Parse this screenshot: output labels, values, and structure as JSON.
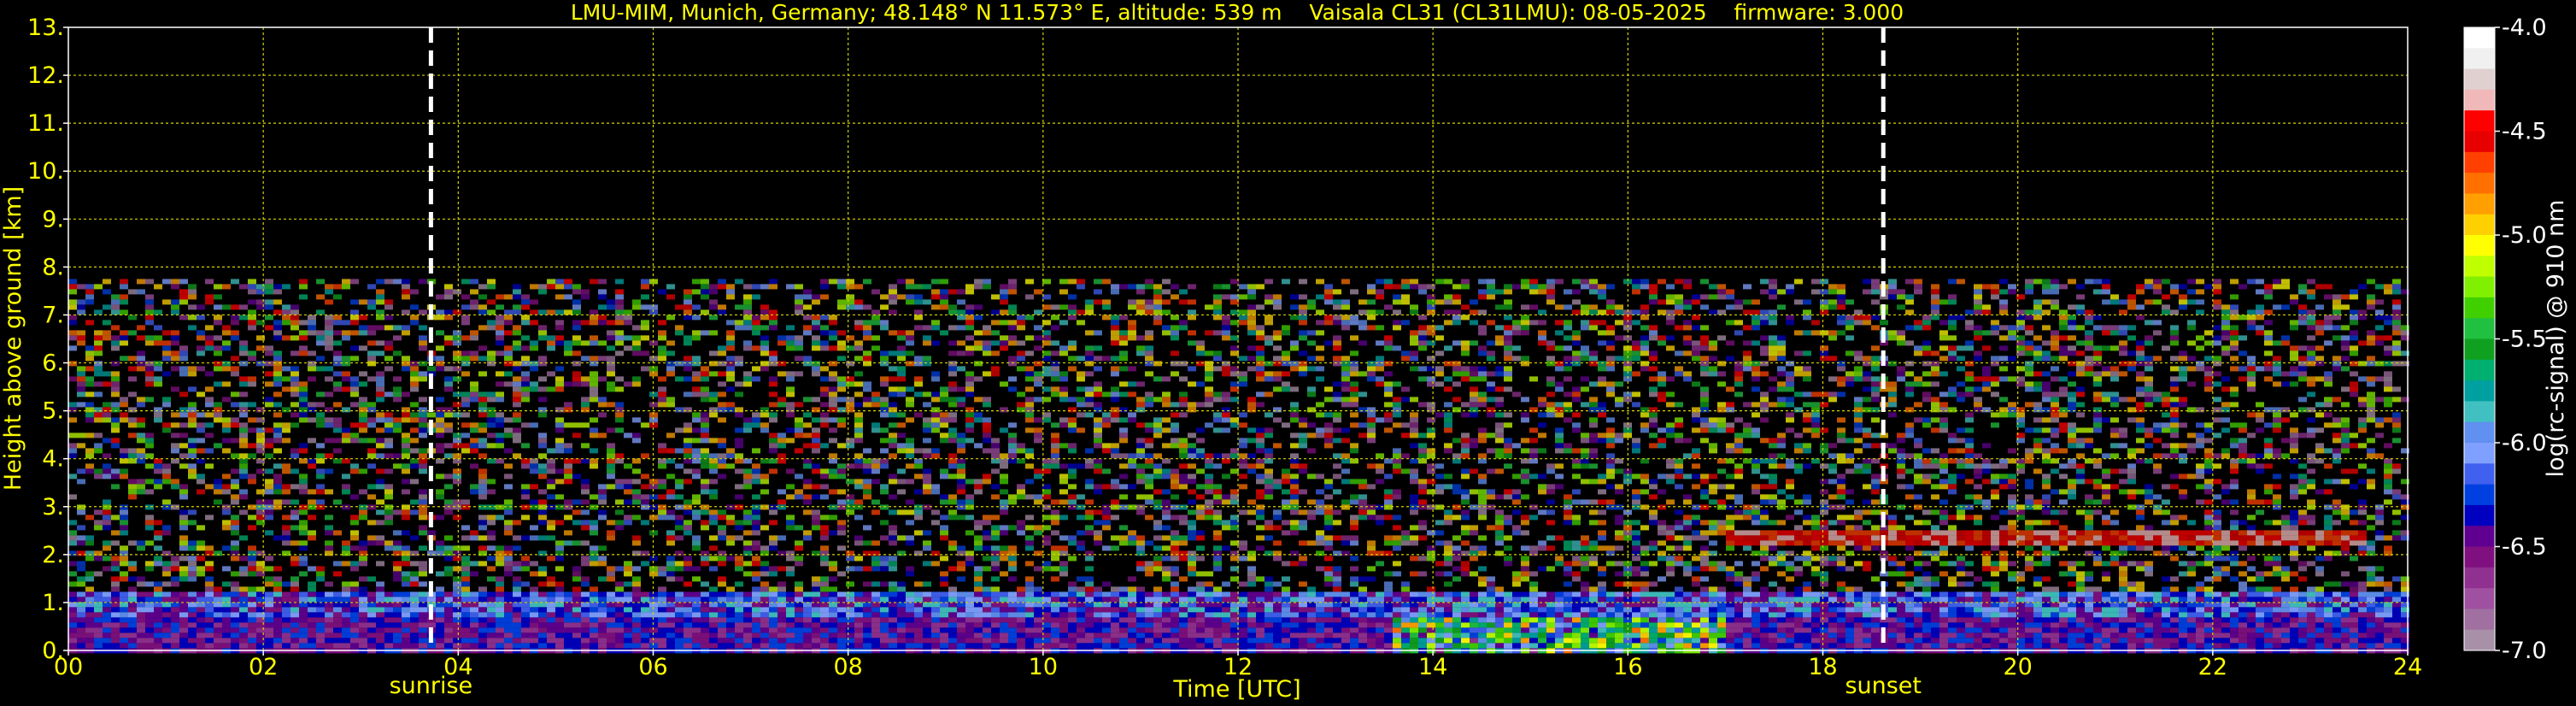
{
  "chart_data": {
    "type": "heatmap",
    "title": "LMU-MIM, Munich, Germany; 48.148° N 11.573° E, altitude: 539 m    Vaisala CL31 (CL31LMU): 08-05-2025    firmware: 3.000",
    "xlabel": "Time [UTC]",
    "ylabel": "Height above ground [km]",
    "xlim": [
      0,
      24
    ],
    "ylim": [
      0,
      13
    ],
    "x_ticks": [
      0,
      2,
      4,
      6,
      8,
      10,
      12,
      14,
      16,
      18,
      20,
      22,
      24
    ],
    "x_tick_labels": [
      "00",
      "02",
      "04",
      "06",
      "08",
      "10",
      "12",
      "14",
      "16",
      "18",
      "20",
      "22",
      "24"
    ],
    "y_ticks": [
      0,
      1,
      2,
      3,
      4,
      5,
      6,
      7,
      8,
      9,
      10,
      11,
      12,
      13
    ],
    "y_tick_labels": [
      "0.",
      "1.",
      "2.",
      "3.",
      "4.",
      "5.",
      "6.",
      "7.",
      "8.",
      "9.",
      "10.",
      "11.",
      "12.",
      "13."
    ],
    "grid": true,
    "events": [
      {
        "name": "sunrise",
        "time": 3.72
      },
      {
        "name": "sunset",
        "time": 18.62
      }
    ],
    "colorbar": {
      "label": "log(rc-signal) @ 910 nm",
      "vmin": -7.0,
      "vmax": -4.0,
      "ticks": [
        -4.0,
        -4.5,
        -5.0,
        -5.5,
        -6.0,
        -6.5,
        -7.0
      ],
      "tick_labels": [
        "-4.0",
        "-4.5",
        "-5.0",
        "-5.5",
        "-6.0",
        "-6.5",
        "-7.0"
      ],
      "colors": [
        "#ffffff",
        "#f0f0f0",
        "#e0d0d0",
        "#f0b8b8",
        "#ff0000",
        "#e80000",
        "#ff4000",
        "#ff7000",
        "#ffa000",
        "#ffd000",
        "#ffff00",
        "#c0ff00",
        "#80f000",
        "#40d000",
        "#20c040",
        "#10a020",
        "#00b070",
        "#00a0a0",
        "#40c0c0",
        "#6090f0",
        "#80a0ff",
        "#4060f0",
        "#0040e0",
        "#0000c0",
        "#600090",
        "#801080",
        "#903090",
        "#a050a0",
        "#a070a0",
        "#a890a8"
      ]
    },
    "series": []
  }
}
